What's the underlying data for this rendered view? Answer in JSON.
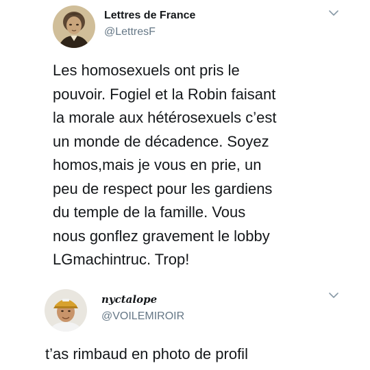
{
  "tweets": [
    {
      "display_name": "Lettres de France",
      "handle": "@LettresF",
      "text": "Les homosexuels ont pris le\npouvoir. Fogiel et la Robin faisant\nla morale aux hétérosexuels c’est\nun monde de décadence. Soyez\nhomos,mais je vous en prie, un\npeu de respect pour les gardiens\ndu temple de la famille. Vous\nnous gonflez gravement le lobby\nLGmachintruc. Trop!",
      "avatar_icon": "sepia-portrait-avatar"
    },
    {
      "display_name": "nyctalope",
      "handle": "@VOILEMIROIR",
      "text": "t’as rimbaud en photo de profil",
      "avatar_icon": "man-with-cap-avatar"
    }
  ],
  "colors": {
    "text": "#14171a",
    "secondary": "#657786",
    "chevron": "#8899a6"
  },
  "icons": {
    "menu": "chevron-down-icon"
  }
}
